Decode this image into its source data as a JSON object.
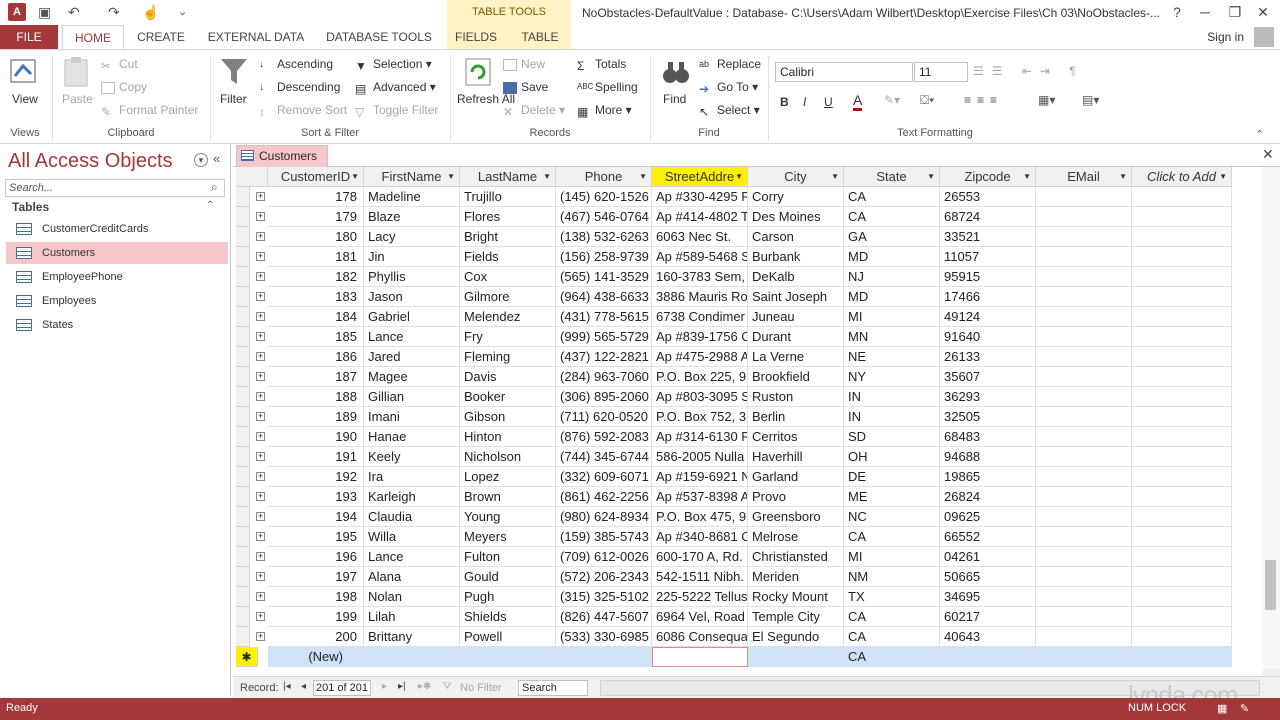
{
  "window": {
    "title": "NoObstacles-DefaultValue : Database- C:\\Users\\Adam Wilbert\\Desktop\\Exercise Files\\Ch 03\\NoObstacles-...",
    "context_tab_group": "TABLE TOOLS",
    "help": "?",
    "sign_in": "Sign in"
  },
  "tabs": {
    "file": "FILE",
    "home": "HOME",
    "create": "CREATE",
    "external_data": "EXTERNAL DATA",
    "database_tools": "DATABASE TOOLS",
    "fields": "FIELDS",
    "table": "TABLE"
  },
  "ribbon": {
    "views": {
      "label": "Views",
      "view": "View"
    },
    "clipboard": {
      "label": "Clipboard",
      "paste": "Paste",
      "cut": "Cut",
      "copy": "Copy",
      "format_painter": "Format Painter"
    },
    "sort_filter": {
      "label": "Sort & Filter",
      "filter": "Filter",
      "ascending": "Ascending",
      "descending": "Descending",
      "remove_sort": "Remove Sort",
      "selection": "Selection",
      "advanced": "Advanced",
      "toggle_filter": "Toggle Filter"
    },
    "records": {
      "label": "Records",
      "refresh_all": "Refresh All",
      "new": "New",
      "save": "Save",
      "delete": "Delete",
      "totals": "Totals",
      "spelling": "Spelling",
      "more": "More"
    },
    "find": {
      "label": "Find",
      "find": "Find",
      "replace": "Replace",
      "go_to": "Go To",
      "select": "Select"
    },
    "text_formatting": {
      "label": "Text Formatting",
      "font": "Calibri",
      "size": "11",
      "bold": "B",
      "italic": "I",
      "underline": "U"
    }
  },
  "nav": {
    "title": "All Access Objects",
    "search_placeholder": "Search...",
    "section": "Tables",
    "items": [
      {
        "label": "CustomerCreditCards",
        "selected": false
      },
      {
        "label": "Customers",
        "selected": true
      },
      {
        "label": "EmployeePhone",
        "selected": false
      },
      {
        "label": "Employees",
        "selected": false
      },
      {
        "label": "States",
        "selected": false
      }
    ]
  },
  "document": {
    "tab": "Customers",
    "columns": [
      "CustomerID",
      "FirstName",
      "LastName",
      "Phone",
      "StreetAddre",
      "City",
      "State",
      "Zipcode",
      "EMail",
      "Click to Add"
    ],
    "rows": [
      [
        "178",
        "Madeline",
        "Trujillo",
        "(145) 620-1526",
        "Ap #330-4295 F",
        "Corry",
        "CA",
        "26553",
        ""
      ],
      [
        "179",
        "Blaze",
        "Flores",
        "(467) 546-0764",
        "Ap #414-4802 T",
        "Des Moines",
        "CA",
        "68724",
        ""
      ],
      [
        "180",
        "Lacy",
        "Bright",
        "(138) 532-6263",
        "6063 Nec St.",
        "Carson",
        "GA",
        "33521",
        ""
      ],
      [
        "181",
        "Jin",
        "Fields",
        "(156) 258-9739",
        "Ap #589-5468 S",
        "Burbank",
        "MD",
        "11057",
        ""
      ],
      [
        "182",
        "Phyllis",
        "Cox",
        "(565) 141-3529",
        "160-3783 Sem,",
        "DeKalb",
        "NJ",
        "95915",
        ""
      ],
      [
        "183",
        "Jason",
        "Gilmore",
        "(964) 438-6633",
        "3886 Mauris Ro",
        "Saint Joseph",
        "MD",
        "17466",
        ""
      ],
      [
        "184",
        "Gabriel",
        "Melendez",
        "(431) 778-5615",
        "6738 Condimer",
        "Juneau",
        "MI",
        "49124",
        ""
      ],
      [
        "185",
        "Lance",
        "Fry",
        "(999) 565-5729",
        "Ap #839-1756 C",
        "Durant",
        "MN",
        "91640",
        ""
      ],
      [
        "186",
        "Jared",
        "Fleming",
        "(437) 122-2821",
        "Ap #475-2988 A",
        "La Verne",
        "NE",
        "26133",
        ""
      ],
      [
        "187",
        "Magee",
        "Davis",
        "(284) 963-7060",
        "P.O. Box 225, 9",
        "Brookfield",
        "NY",
        "35607",
        ""
      ],
      [
        "188",
        "Gillian",
        "Booker",
        "(306) 895-2060",
        "Ap #803-3095 S",
        "Ruston",
        "IN",
        "36293",
        ""
      ],
      [
        "189",
        "Imani",
        "Gibson",
        "(711) 620-0520",
        "P.O. Box 752, 3",
        "Berlin",
        "IN",
        "32505",
        ""
      ],
      [
        "190",
        "Hanae",
        "Hinton",
        "(876) 592-2083",
        "Ap #314-6130 F",
        "Cerritos",
        "SD",
        "68483",
        ""
      ],
      [
        "191",
        "Keely",
        "Nicholson",
        "(744) 345-6744",
        "586-2005 Nulla",
        "Haverhill",
        "OH",
        "94688",
        ""
      ],
      [
        "192",
        "Ira",
        "Lopez",
        "(332) 609-6071",
        "Ap #159-6921 N",
        "Garland",
        "DE",
        "19865",
        ""
      ],
      [
        "193",
        "Karleigh",
        "Brown",
        "(861) 462-2256",
        "Ap #537-8398 A",
        "Provo",
        "ME",
        "26824",
        ""
      ],
      [
        "194",
        "Claudia",
        "Young",
        "(980) 624-8934",
        "P.O. Box 475, 9",
        "Greensboro",
        "NC",
        "09625",
        ""
      ],
      [
        "195",
        "Willa",
        "Meyers",
        "(159) 385-5743",
        "Ap #340-8681 C",
        "Melrose",
        "CA",
        "66552",
        ""
      ],
      [
        "196",
        "Lance",
        "Fulton",
        "(709) 612-0026",
        "600-170 A, Rd.",
        "Christiansted",
        "MI",
        "04261",
        ""
      ],
      [
        "197",
        "Alana",
        "Gould",
        "(572) 206-2343",
        "542-1511 Nibh.",
        "Meriden",
        "NM",
        "50665",
        ""
      ],
      [
        "198",
        "Nolan",
        "Pugh",
        "(315) 325-5102",
        "225-5222 Tellus",
        "Rocky Mount",
        "TX",
        "34695",
        ""
      ],
      [
        "199",
        "Lilah",
        "Shields",
        "(826) 447-5607",
        "6964 Vel, Road",
        "Temple City",
        "CA",
        "60217",
        ""
      ],
      [
        "200",
        "Brittany",
        "Powell",
        "(533) 330-6985",
        "6086 Consequa",
        "El Segundo",
        "CA",
        "40643",
        ""
      ]
    ],
    "new_row": {
      "id": "(New)",
      "state": "CA",
      "marker": "✱"
    }
  },
  "record_nav": {
    "label": "Record:",
    "current": "201 of 201",
    "no_filter": "No Filter",
    "search": "Search"
  },
  "status": {
    "ready": "Ready",
    "num_lock": "NUM LOCK",
    "watermark": "lynda.com"
  },
  "colors": {
    "accent": "#a4373a",
    "highlight_header": "#fff200",
    "selected_nav": "#f6c7ca",
    "new_row": "#cfe2f7"
  }
}
